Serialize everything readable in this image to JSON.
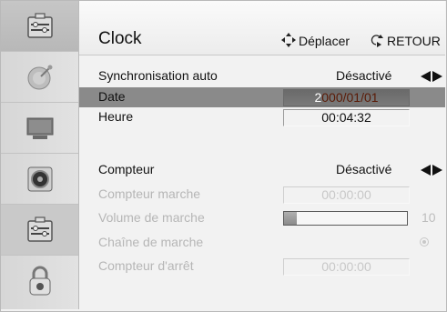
{
  "sidebar": {
    "items": [
      {
        "name": "setup-icon"
      },
      {
        "name": "satellite-dish-icon"
      },
      {
        "name": "monitor-icon"
      },
      {
        "name": "speaker-icon"
      },
      {
        "name": "setup-icon"
      },
      {
        "name": "lock-icon"
      }
    ],
    "selected_index": 0
  },
  "header": {
    "title": "Clock",
    "move_hint": "Déplacer",
    "back_hint": "RETOUR"
  },
  "rows": {
    "sync_auto": {
      "label": "Synchronisation auto",
      "value": "Désactivé"
    },
    "date": {
      "label": "Date",
      "cursor_char": "2",
      "value_rest": "000/01/01"
    },
    "heure": {
      "label": "Heure",
      "value": "00:04:32"
    },
    "compteur": {
      "label": "Compteur",
      "value": "Désactivé"
    },
    "compteur_marche": {
      "label": "Compteur marche",
      "value": "00:00:00"
    },
    "volume_marche": {
      "label": "Volume de marche",
      "value": "10",
      "level_fraction": 0.1
    },
    "chaine_marche": {
      "label": "Chaîne de marche"
    },
    "compteur_arret": {
      "label": "Compteur d'arrêt",
      "value": "00:00:00"
    }
  }
}
